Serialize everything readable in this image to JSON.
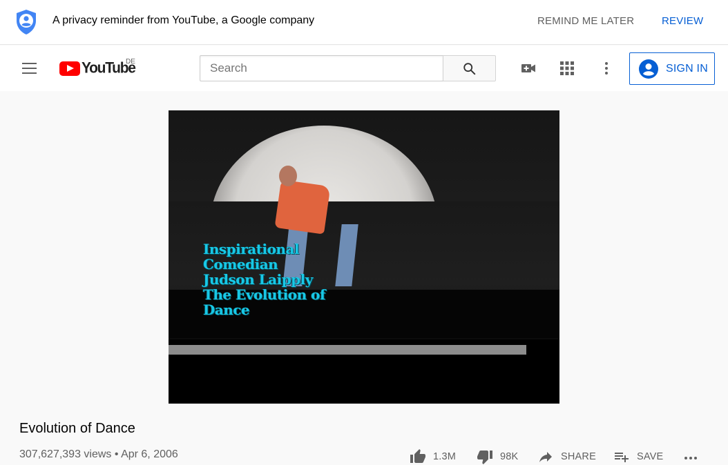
{
  "privacy_banner": {
    "message": "A privacy reminder from YouTube, a Google company",
    "remind_later_label": "REMIND ME LATER",
    "review_label": "REVIEW",
    "accent_color": "#065fd4"
  },
  "masthead": {
    "logo_text": "YouTube",
    "country_code": "DE",
    "search_placeholder": "Search",
    "search_value": "",
    "sign_in_label": "SIGN IN",
    "icons": [
      "menu-icon",
      "youtube-logo-icon",
      "search-icon",
      "create-video-icon",
      "apps-grid-icon",
      "more-vert-icon",
      "account-circle-icon"
    ]
  },
  "player": {
    "caption_lines": [
      "Inspirational",
      "Comedian",
      "Judson Laipply",
      "The Evolution of",
      "Dance"
    ],
    "progress": 0.915
  },
  "video": {
    "title": "Evolution of Dance",
    "views": "307,627,393 views",
    "separator": "•",
    "date": "Apr 6, 2006"
  },
  "actions": {
    "like_count": "1.3M",
    "dislike_count": "98K",
    "share_label": "SHARE",
    "save_label": "SAVE",
    "icons": [
      "thumb-up-icon",
      "thumb-down-icon",
      "share-icon",
      "playlist-add-icon",
      "more-horiz-icon"
    ]
  }
}
